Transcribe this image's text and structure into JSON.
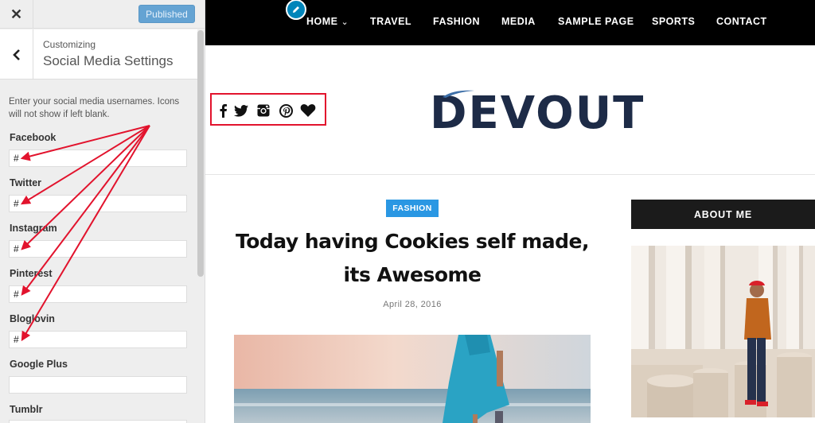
{
  "sidebar": {
    "close_symbol": "✕",
    "publish_label": "Published",
    "breadcrumb": "Customizing",
    "section_title": "Social Media Settings",
    "description": "Enter your social media usernames. Icons will not show if left blank.",
    "fields": [
      {
        "label": "Facebook",
        "value": "#"
      },
      {
        "label": "Twitter",
        "value": "#"
      },
      {
        "label": "Instagram",
        "value": "#"
      },
      {
        "label": "Pinterest",
        "value": "#"
      },
      {
        "label": "Bloglovin",
        "value": "#"
      },
      {
        "label": "Google Plus",
        "value": ""
      },
      {
        "label": "Tumblr",
        "value": ""
      }
    ]
  },
  "preview": {
    "nav": [
      "HOME",
      "TRAVEL",
      "FASHION",
      "MEDIA",
      "SAMPLE PAGE",
      "SPORTS",
      "CONTACT"
    ],
    "home_chevron": "⌄",
    "social_icons": [
      "facebook-icon",
      "twitter-icon",
      "instagram-icon",
      "pinterest-icon",
      "bloglovin-heart-icon"
    ],
    "logo": "DEVOUT",
    "post": {
      "category": "FASHION",
      "title": "Today having Cookies self made, its Awesome",
      "date": "April 28, 2016"
    },
    "widget": {
      "title": "ABOUT ME"
    }
  },
  "colors": {
    "annotation": "#e2132d",
    "publish_button": "#64a3d3",
    "badge": "#2a97e3",
    "edit_shortcut": "#0085ba",
    "logo": "#1d2b47"
  }
}
